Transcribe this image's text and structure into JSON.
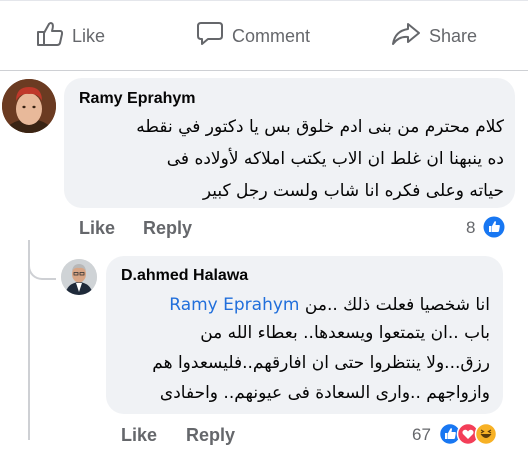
{
  "actions": {
    "like": "Like",
    "comment": "Comment",
    "share": "Share"
  },
  "comment1": {
    "author": "Ramy Eprahym",
    "lines": [
      "كلام محترم من بنى ادم خلوق بس يا دكتور في نقطه",
      "ده ينبهنا ان غلط ان الاب يكتب املاكه لأولاده فى",
      "حياته وعلى فكره انا شاب ولست رجل كبير"
    ],
    "like_label": "Like",
    "reply_label": "Reply",
    "reaction_count": "8"
  },
  "reply1": {
    "author": "D.ahmed Halawa",
    "line1_text": "انا شخصيا فعلت ذلك ..من",
    "mention": "Ramy Eprahym",
    "lines": [
      "باب ..ان يتمتعوا ويسعدها.. بعطاء الله من",
      "رزق...ولا ينتظروا حتى ان افارقهم..فليسعدوا هم",
      "وازواجهم ..وارى السعادة فى عيونهم.. واحفادى"
    ],
    "like_label": "Like",
    "reply_label": "Reply",
    "reaction_count": "67"
  },
  "colors": {
    "bubble": "#f0f2f5",
    "like_blue": "#1877f2",
    "love_red": "#f33e58",
    "haha_yellow": "#f7b125",
    "link": "#216fdb",
    "muted": "#65676b"
  }
}
